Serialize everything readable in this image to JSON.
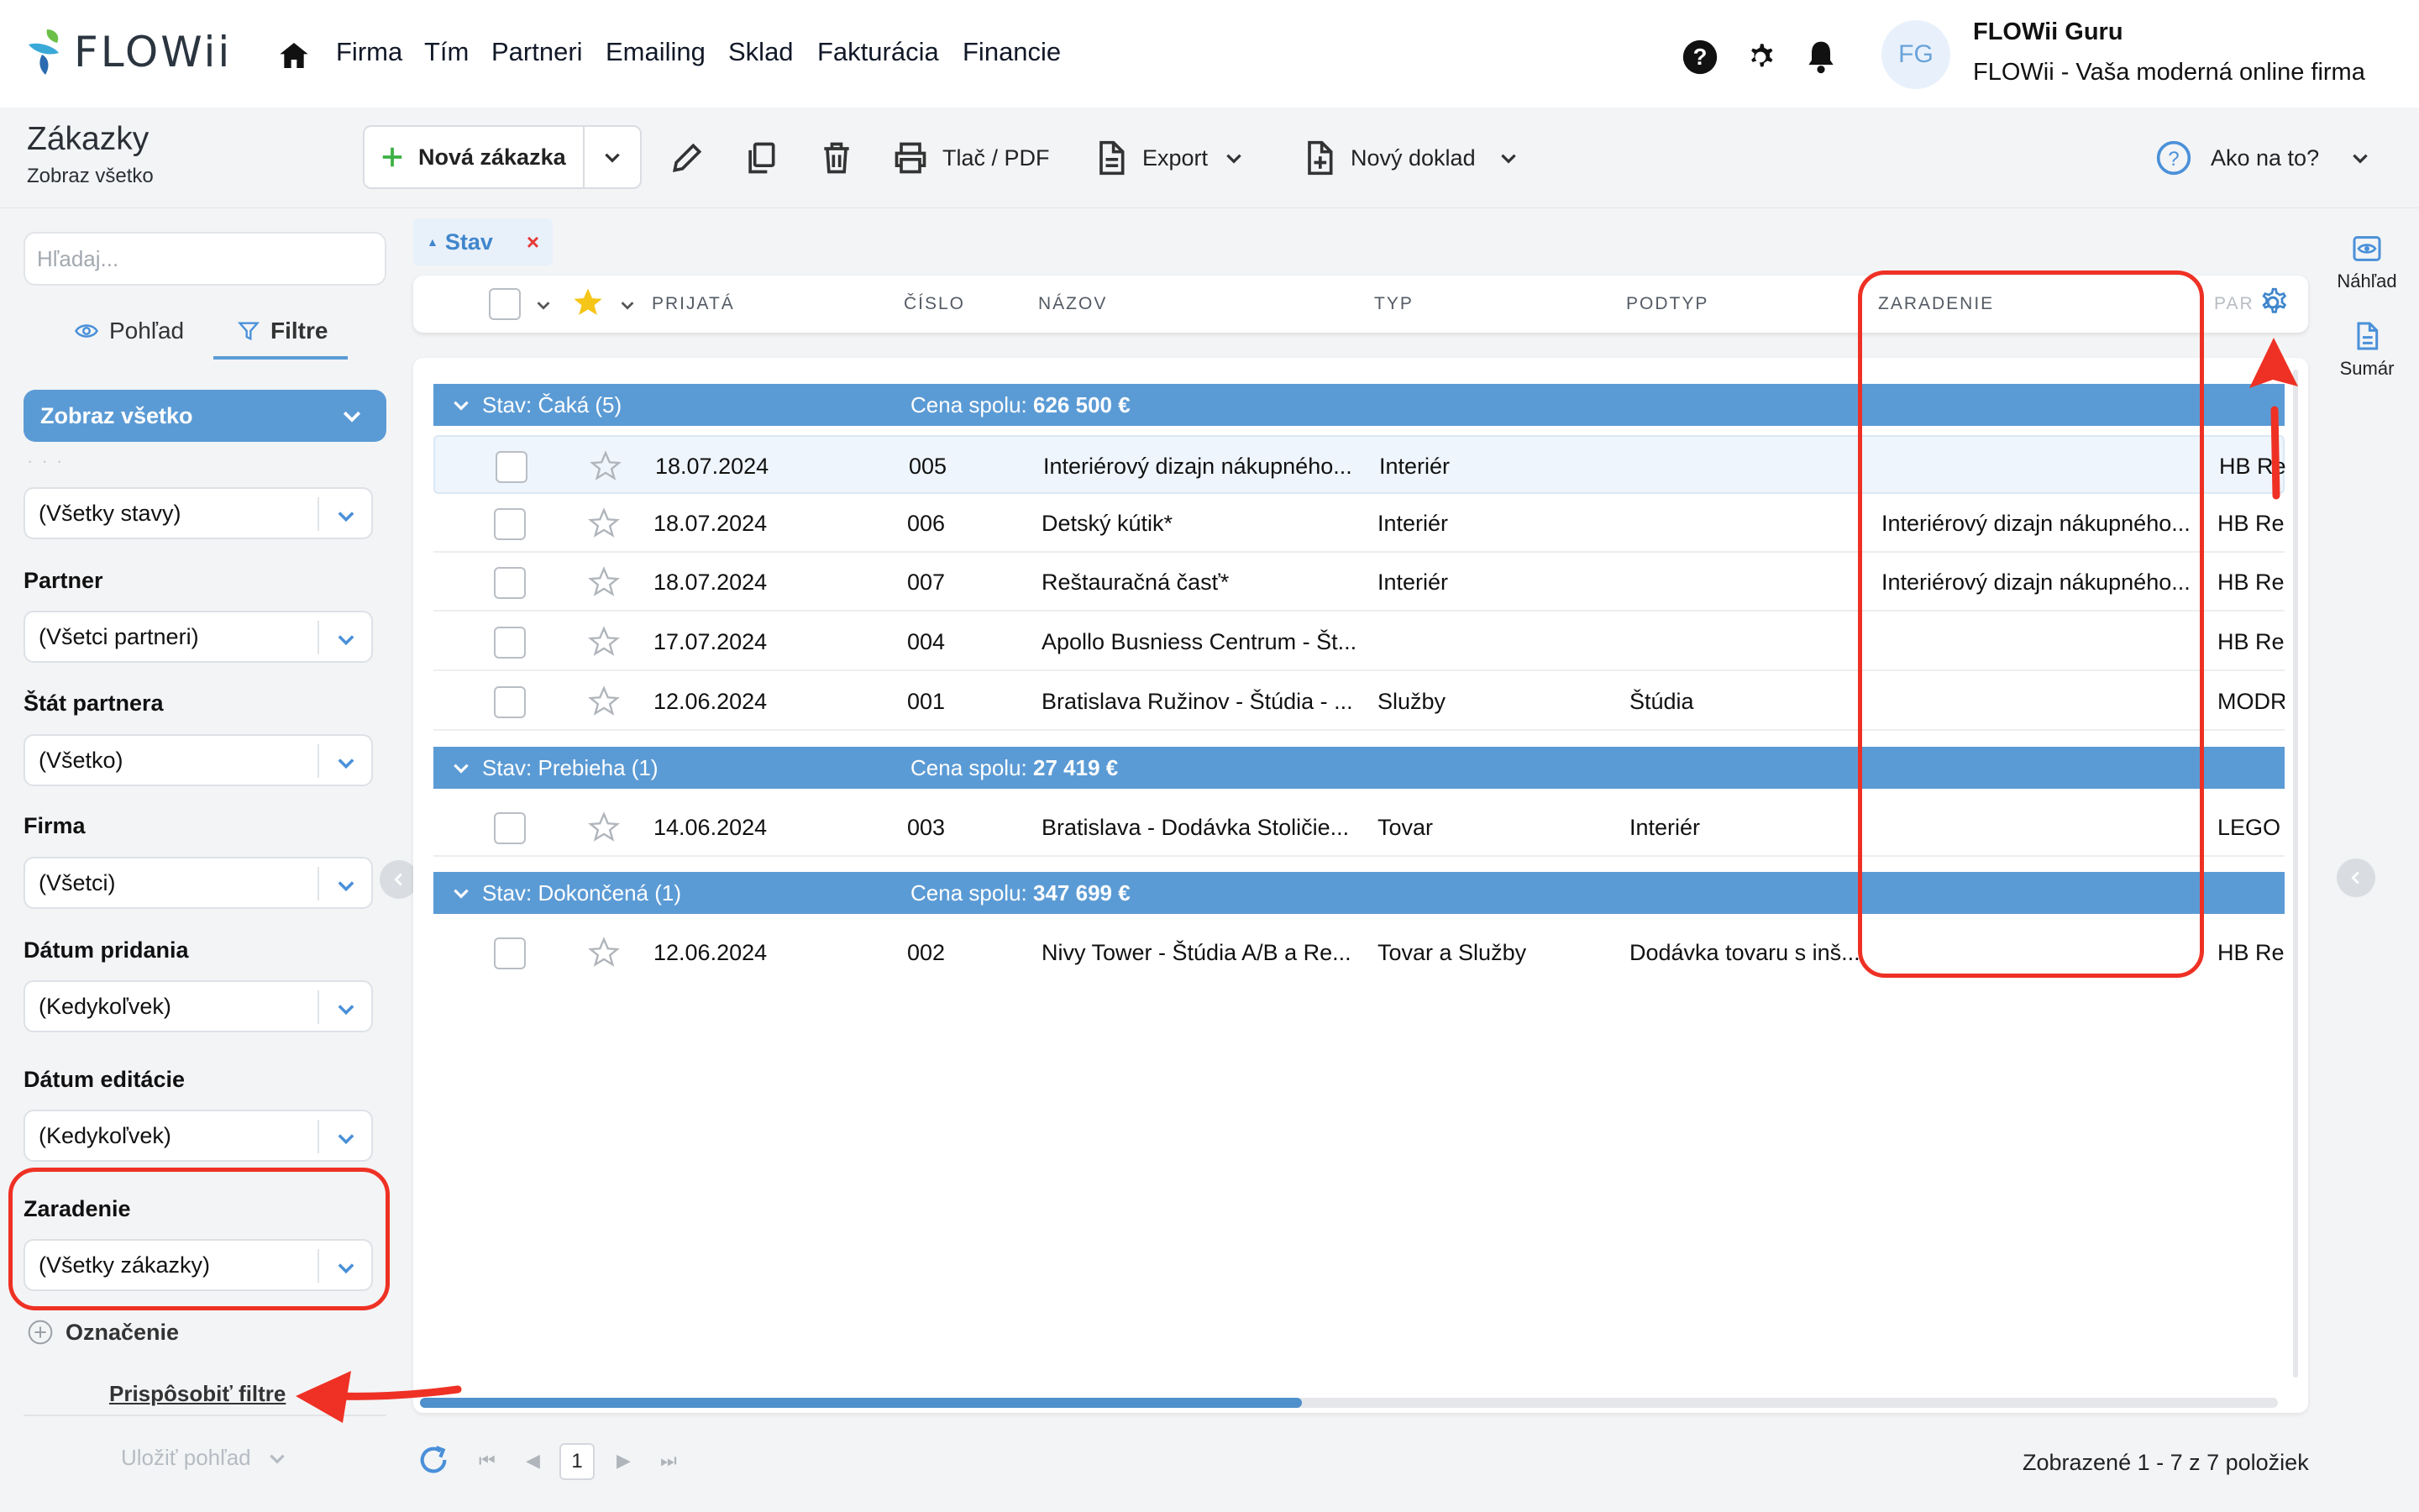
{
  "app": {
    "logo_text": "FLOWii",
    "nav": [
      "Firma",
      "Tím",
      "Partneri",
      "Emailing",
      "Sklad",
      "Fakturácia",
      "Financie"
    ],
    "user": {
      "initials": "FG",
      "name": "FLOWii Guru",
      "company": "FLOWii - Vaša moderná online firma"
    }
  },
  "page": {
    "title": "Zákazky",
    "subtitle": "Zobraz všetko"
  },
  "toolbar": {
    "new_order": "Nová zákazka",
    "print": "Tlač / PDF",
    "export": "Export",
    "new_doc": "Nový doklad",
    "help": "Ako na to?"
  },
  "sidebar": {
    "search_placeholder": "Hľadaj...",
    "tab_view": "Pohľad",
    "tab_filters": "Filtre",
    "view_select": "Zobraz všetko",
    "dots": "· · ·",
    "filters": [
      {
        "label": "",
        "value": "(Všetky stavy)"
      },
      {
        "label": "Partner",
        "value": "(Všetci partneri)"
      },
      {
        "label": "Štát partnera",
        "value": "(Všetko)"
      },
      {
        "label": "Firma",
        "value": "(Všetci)"
      },
      {
        "label": "Dátum pridania",
        "value": "(Kedykoľvek)"
      },
      {
        "label": "Dátum editácie",
        "value": "(Kedykoľvek)"
      },
      {
        "label": "Zaradenie",
        "value": "(Všetky zákazky)"
      }
    ],
    "add_filter": "Označenie",
    "customize": "Prispôsobiť filtre",
    "save_view": "Uložiť pohľad"
  },
  "grid": {
    "group_chip": "Stav",
    "group_chip_remove": "×",
    "columns": [
      "PRIJATÁ",
      "ČÍSLO",
      "NÁZOV",
      "TYP",
      "PODTYP",
      "ZARADENIE",
      "PAR"
    ],
    "total_label": "Cena spolu:",
    "groups": [
      {
        "title": "Stav: Čaká (5)",
        "total": "626 500 €",
        "rows": [
          {
            "date": "18.07.2024",
            "num": "005",
            "name": "Interiérový dizajn nákupného...",
            "type": "Interiér",
            "subtype": "",
            "category": "",
            "partner": "HB Real"
          },
          {
            "date": "18.07.2024",
            "num": "006",
            "name": "Detský kútik*",
            "type": "Interiér",
            "subtype": "",
            "category": "Interiérový dizajn nákupného...",
            "partner": "HB Real"
          },
          {
            "date": "18.07.2024",
            "num": "007",
            "name": "Reštauračná časť*",
            "type": "Interiér",
            "subtype": "",
            "category": "Interiérový dizajn nákupného...",
            "partner": "HB Real"
          },
          {
            "date": "17.07.2024",
            "num": "004",
            "name": "Apollo Busniess Centrum - Št...",
            "type": "",
            "subtype": "",
            "category": "",
            "partner": "HB Real"
          },
          {
            "date": "12.06.2024",
            "num": "001",
            "name": "Bratislava Ružinov - Štúdia - ...",
            "type": "Služby",
            "subtype": "Štúdia",
            "category": "",
            "partner": "MODRA"
          }
        ]
      },
      {
        "title": "Stav: Prebieha (1)",
        "total": "27 419 €",
        "rows": [
          {
            "date": "14.06.2024",
            "num": "003",
            "name": "Bratislava - Dodávka Stoličie...",
            "type": "Tovar",
            "subtype": "Interiér",
            "category": "",
            "partner": "LEGO"
          }
        ]
      },
      {
        "title": "Stav: Dokončená (1)",
        "total": "347 699 €",
        "rows": [
          {
            "date": "12.06.2024",
            "num": "002",
            "name": "Nivy Tower - Štúdia A/B a Re...",
            "type": "Tovar a Služby",
            "subtype": "Dodávka tovaru s inš...",
            "category": "",
            "partner": "HB Real"
          }
        ]
      }
    ]
  },
  "footer": {
    "page": "1",
    "count": "Zobrazené 1 - 7 z 7 položiek"
  },
  "right_rail": {
    "preview": "Náhľad",
    "summary": "Sumár"
  },
  "colors": {
    "accent": "#5b9bd5",
    "annotation": "#ee3124",
    "star": "#f5c518"
  }
}
